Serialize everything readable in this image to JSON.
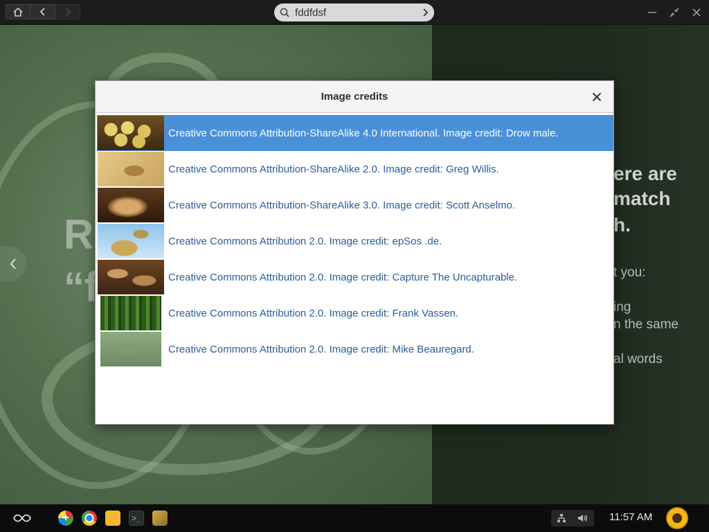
{
  "topbar": {
    "home_icon": "home-icon",
    "back_icon": "chevron-left-icon",
    "forward_icon": "chevron-right-icon",
    "search": {
      "value": "fddfdsf",
      "icon": "search-icon",
      "go_icon": "chevron-right-icon"
    },
    "window_controls": [
      "minimize-icon",
      "restore-icon",
      "close-icon"
    ]
  },
  "background": {
    "left_big_line1": "R",
    "left_big_line2": "“f",
    "right_heading": [
      "ere are",
      "match",
      "h."
    ],
    "right_lines": [
      "t you:",
      "ing",
      "n the same",
      "al words"
    ]
  },
  "dialog": {
    "title": "Image credits",
    "close_icon": "close-icon",
    "items": [
      {
        "label": "Creative Commons Attribution-ShareAlike 4.0 International. Image credit: Drow male.",
        "selected": true
      },
      {
        "label": "Creative Commons Attribution-ShareAlike 2.0. Image credit: Greg Willis.",
        "selected": false
      },
      {
        "label": "Creative Commons Attribution-ShareAlike 3.0. Image credit: Scott Anselmo.",
        "selected": false
      },
      {
        "label": "Creative Commons Attribution 2.0. Image credit: epSos .de.",
        "selected": false
      },
      {
        "label": "Creative Commons Attribution 2.0. Image credit: Capture The Uncapturable.",
        "selected": false
      },
      {
        "label": "Creative Commons Attribution 2.0. Image credit: Frank Vassen.",
        "selected": false
      },
      {
        "label": "Creative Commons Attribution 2.0. Image credit: Mike Beauregard.",
        "selected": false
      }
    ]
  },
  "taskbar": {
    "menu_icon": "endless-menu-icon",
    "apps": [
      "add-app-icon",
      "chrome-icon",
      "files-icon",
      "terminal-icon",
      "dinosaur-app-icon"
    ],
    "tray": [
      "network-icon",
      "volume-icon"
    ],
    "clock": "11:57 AM",
    "user_icon": "sunflower-avatar-icon"
  },
  "colors": {
    "selection": "#4a90d9",
    "link": "#2a5d99",
    "background_green": "#55704f"
  }
}
